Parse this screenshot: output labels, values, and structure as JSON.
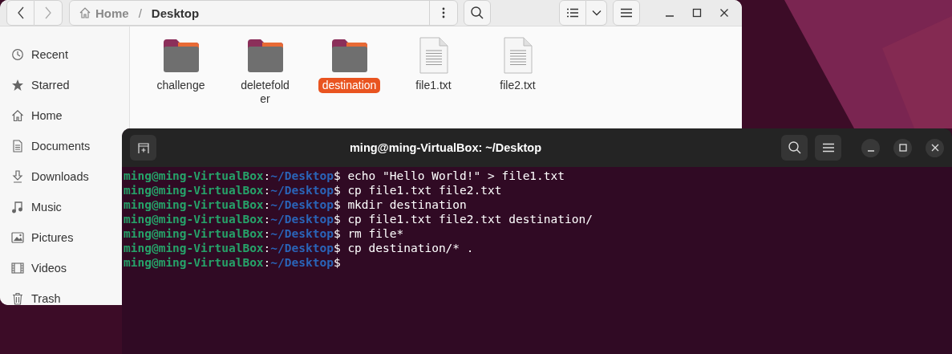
{
  "file_manager": {
    "path": {
      "separator": "/",
      "crumbs": [
        {
          "label": "Home",
          "current": false
        },
        {
          "label": "Desktop",
          "current": true
        }
      ]
    },
    "sidebar": {
      "items": [
        {
          "label": "Recent"
        },
        {
          "label": "Starred"
        },
        {
          "label": "Home"
        },
        {
          "label": "Documents"
        },
        {
          "label": "Downloads"
        },
        {
          "label": "Music"
        },
        {
          "label": "Pictures"
        },
        {
          "label": "Videos"
        },
        {
          "label": "Trash"
        }
      ]
    },
    "files": [
      {
        "name": "challenge",
        "kind": "folder",
        "selected": false
      },
      {
        "name": "deletefolder",
        "kind": "folder",
        "selected": false
      },
      {
        "name": "destination",
        "kind": "folder",
        "selected": true
      },
      {
        "name": "file1.txt",
        "kind": "text",
        "selected": false
      },
      {
        "name": "file2.txt",
        "kind": "text",
        "selected": false
      }
    ]
  },
  "terminal": {
    "title": "ming@ming-VirtualBox: ~/Desktop",
    "lines": [
      {
        "user": "ming@ming-VirtualBox",
        "colon": ":",
        "path": "~/Desktop",
        "sign": "$",
        "command": "echo \"Hello World!\" > file1.txt"
      },
      {
        "user": "ming@ming-VirtualBox",
        "colon": ":",
        "path": "~/Desktop",
        "sign": "$",
        "command": "cp file1.txt file2.txt"
      },
      {
        "user": "ming@ming-VirtualBox",
        "colon": ":",
        "path": "~/Desktop",
        "sign": "$",
        "command": "mkdir destination"
      },
      {
        "user": "ming@ming-VirtualBox",
        "colon": ":",
        "path": "~/Desktop",
        "sign": "$",
        "command": "cp file1.txt file2.txt destination/"
      },
      {
        "user": "ming@ming-VirtualBox",
        "colon": ":",
        "path": "~/Desktop",
        "sign": "$",
        "command": "rm file*"
      },
      {
        "user": "ming@ming-VirtualBox",
        "colon": ":",
        "path": "~/Desktop",
        "sign": "$",
        "command": "cp destination/* ."
      },
      {
        "user": "ming@ming-VirtualBox",
        "colon": ":",
        "path": "~/Desktop",
        "sign": "$"
      }
    ]
  }
}
